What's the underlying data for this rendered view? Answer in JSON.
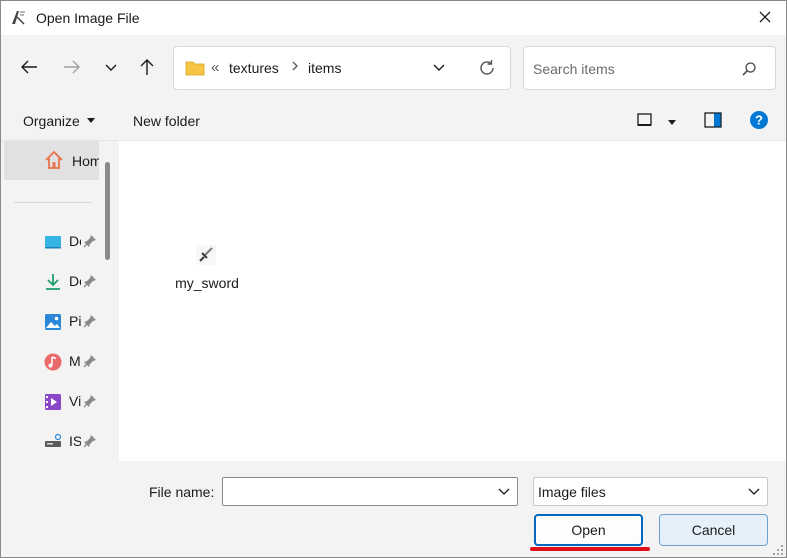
{
  "window": {
    "title": "Open Image File",
    "app_icon": "inkscape-pen-icon",
    "close_icon": "close-icon"
  },
  "nav": {
    "back_icon": "arrow-left-icon",
    "forward_icon": "arrow-right-icon",
    "recent_icon": "chevron-down-icon",
    "up_icon": "arrow-up-icon",
    "breadcrumb_overflow": "«",
    "breadcrumbs": [
      "textures",
      "items"
    ],
    "search_placeholder": "Search items"
  },
  "commands": {
    "organize": "Organize",
    "new_folder": "New folder"
  },
  "sidebar": {
    "home_label": "Home",
    "items": [
      {
        "label": "Desktop",
        "icon": "desktop-icon"
      },
      {
        "label": "Downloads",
        "icon": "download-icon"
      },
      {
        "label": "Pictures",
        "icon": "pictures-icon"
      },
      {
        "label": "Music",
        "icon": "music-icon"
      },
      {
        "label": "Videos",
        "icon": "videos-icon"
      },
      {
        "label": "ISO",
        "icon": "drive-icon"
      }
    ]
  },
  "files": [
    {
      "name": "my_sword",
      "icon": "sword-image-icon"
    }
  ],
  "footer": {
    "file_name_label": "File name:",
    "file_name_value": "",
    "file_type": "Image files",
    "open_label": "Open",
    "cancel_label": "Cancel"
  },
  "colors": {
    "accent": "#0067c0",
    "highlight_mark": "#e0101a",
    "chrome_bg": "#f3f3f3",
    "help": "#0078d4",
    "folder": "#f6c543"
  }
}
